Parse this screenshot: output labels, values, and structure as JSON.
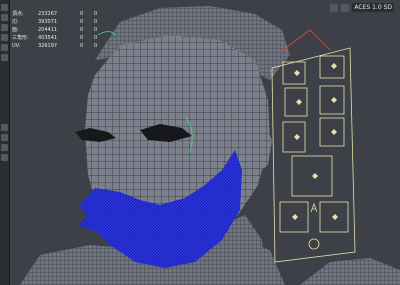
{
  "hud": {
    "rows": [
      {
        "label": "頂点:",
        "value": "233267",
        "v2": "0",
        "v3": "0"
      },
      {
        "label": "辺:",
        "value": "393071",
        "v2": "0",
        "v3": "0"
      },
      {
        "label": "面:",
        "value": "204411",
        "v2": "0",
        "v3": "0"
      },
      {
        "label": "三角形:",
        "value": "403541",
        "v2": "0",
        "v3": "0"
      },
      {
        "label": "UV:",
        "value": "326197",
        "v2": "0",
        "v3": "0"
      }
    ]
  },
  "top_right": {
    "color_space": "ACES 1.0 SD",
    "icons": [
      "camera-icon",
      "display-icon"
    ]
  },
  "colors": {
    "viewport_bg": "#3d4147",
    "mesh": "#7b808c",
    "wire": "#2a2c30",
    "beard": "#1f2ad6",
    "rig_outline": "#e7e1a8",
    "rig_control": "#e7e1a8",
    "selection": "#d84b3a",
    "selection_green": "#49d487"
  }
}
